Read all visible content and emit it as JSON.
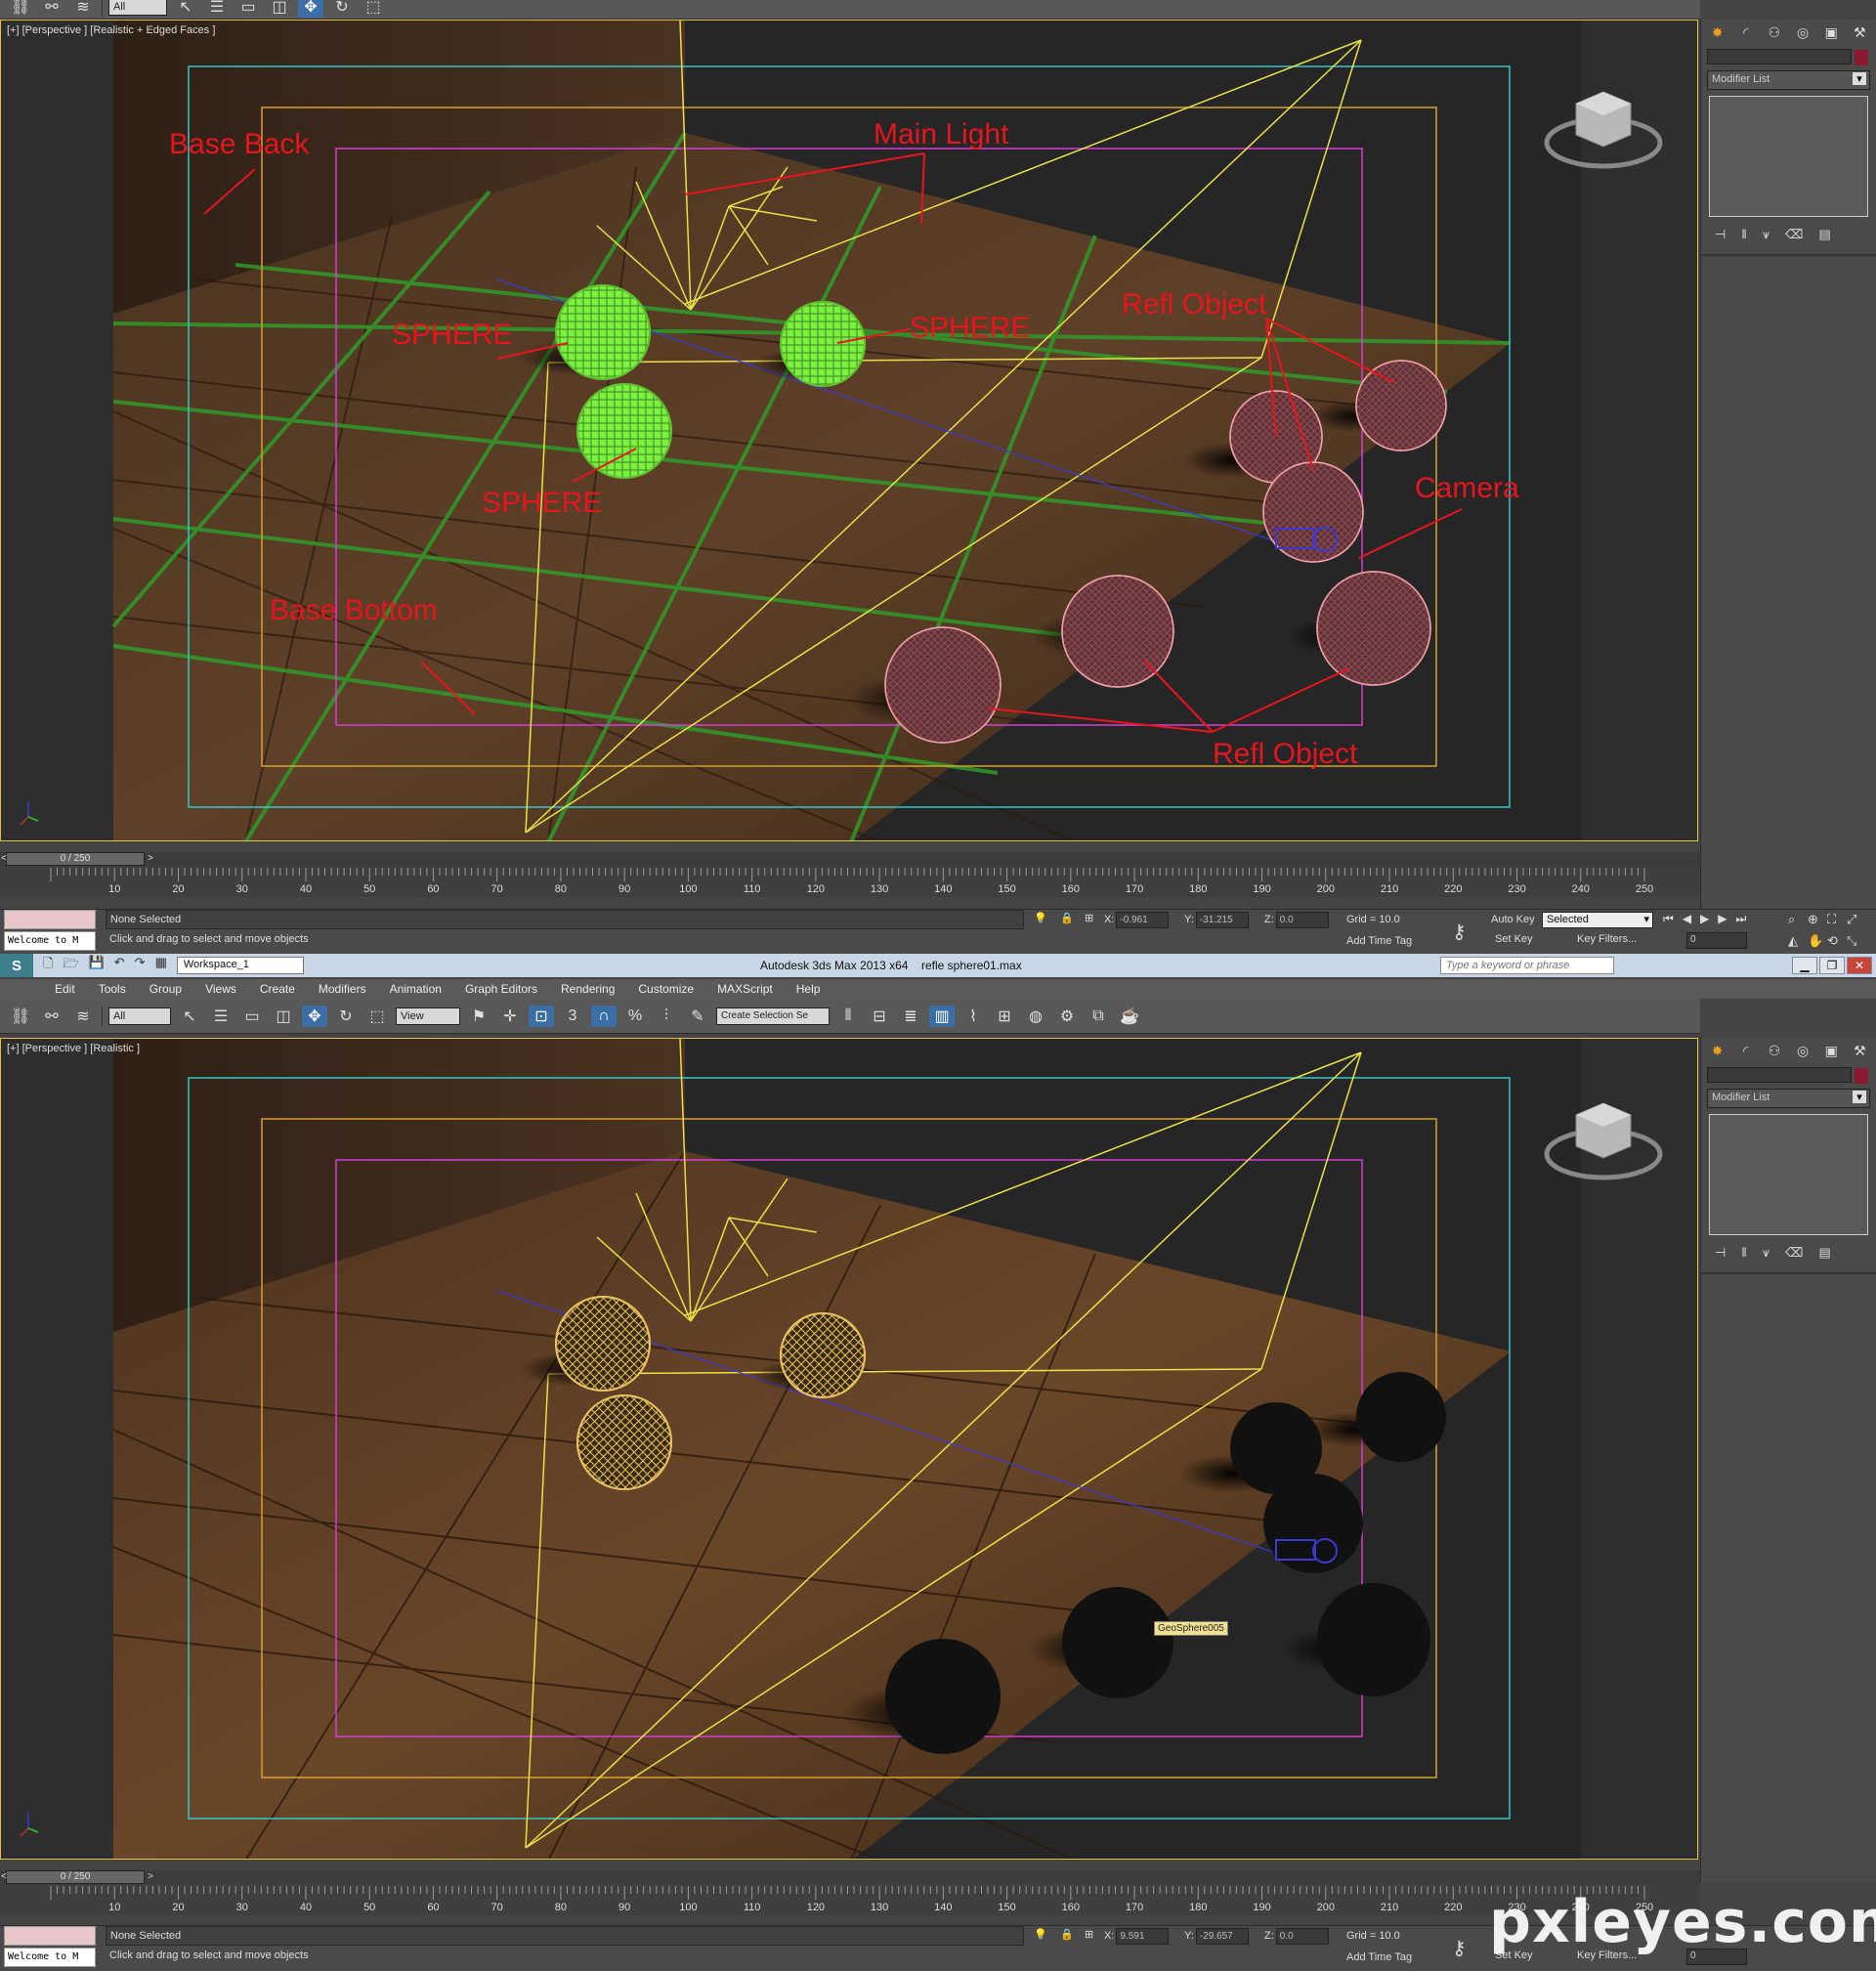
{
  "app": {
    "title": "Autodesk 3ds Max  2013 x64",
    "file": "refle sphere01.max",
    "search_placeholder": "Type a keyword or phrase",
    "workspace": "Workspace_1",
    "menus": [
      "Edit",
      "Tools",
      "Group",
      "Views",
      "Create",
      "Modifiers",
      "Animation",
      "Graph Editors",
      "Rendering",
      "Customize",
      "MAXScript",
      "Help"
    ]
  },
  "toolbar": {
    "filter_select": "All",
    "ref_coord": "View",
    "selection_set": "Create Selection Se",
    "snap_number": "3"
  },
  "viewport_top": {
    "label": "[+] [Perspective ] [Realistic + Edged Faces ]",
    "annotations": [
      "Base Back",
      "Main Light",
      "SPHERE",
      "SPHERE",
      "SPHERE",
      "Refl Object",
      "Camera",
      "Base Bottom",
      "Refl Object"
    ]
  },
  "viewport_bottom": {
    "label": "[+] [Perspective ] [Realistic ]",
    "tooltip": "GeoSphere005"
  },
  "command_panel": {
    "modifier_list": "Modifier List"
  },
  "timeline": {
    "frame_range": "0 / 250",
    "ticks": [
      "10",
      "20",
      "30",
      "40",
      "50",
      "60",
      "70",
      "80",
      "90",
      "100",
      "110",
      "120",
      "130",
      "140",
      "150",
      "160",
      "170",
      "180",
      "190",
      "200",
      "210",
      "220",
      "230",
      "240",
      "250"
    ]
  },
  "status_top": {
    "welcome": "Welcome to M",
    "selection": "None Selected",
    "prompt": "Click and drag to select and move objects",
    "x": "-0.961",
    "y": "-31.215",
    "z": "0.0",
    "grid": "Grid = 10.0",
    "add_time_tag": "Add Time Tag",
    "auto_key": "Auto Key",
    "set_key": "Set Key",
    "key_mode": "Selected",
    "key_filters": "Key Filters...",
    "frame": "0"
  },
  "status_bottom": {
    "welcome": "Welcome to M",
    "selection": "None Selected",
    "prompt": "Click and drag to select and move objects",
    "x": "9.591",
    "y": "-29.657",
    "z": "0.0",
    "grid": "Grid = 10.0",
    "add_time_tag": "Add Time Tag",
    "set_key": "Set Key",
    "key_filters": "Key Filters...",
    "frame": "0"
  },
  "coord_labels": {
    "x": "X:",
    "y": "Y:",
    "z": "Z:"
  },
  "watermark": "pxleyes.com",
  "colors": {
    "annotation": "#e8141e",
    "light_wire": "#e8e04a",
    "sphere_green": "#7cf040",
    "sphere_pink": "#f0a0a8",
    "floor_wood": "#5a3c22",
    "safe_frame_cyan": "#36c6c6",
    "safe_frame_magenta": "#d63cd6",
    "safe_frame_orange": "#d6a030",
    "viewport_border": "#e0c040"
  }
}
